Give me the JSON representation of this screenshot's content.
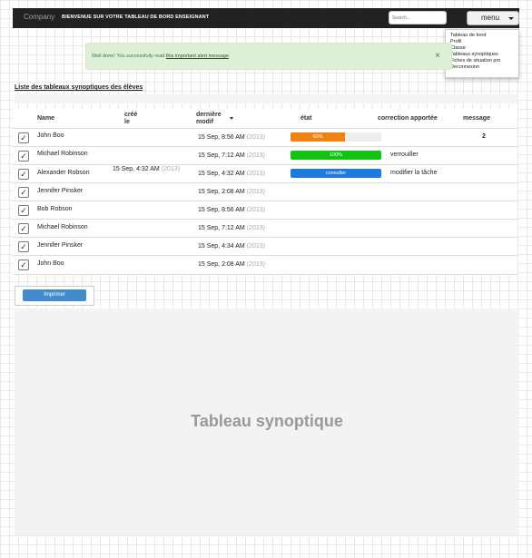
{
  "navbar": {
    "brand": "Company",
    "welcome": "BIENVENUE SUR VOTRE TABLEAU DE BORD ENSEIGNANT",
    "search_placeholder": "Search...",
    "menu_label": "menu"
  },
  "dropdown": {
    "items": [
      "Tableau de bord",
      "Profil",
      "Classe",
      "Tableaux synoptiques",
      "Fiches de situation pro",
      "Deconnexion"
    ]
  },
  "alert": {
    "text": "Well done! You successfully read ",
    "link": "this important alert message",
    "end": ".",
    "close": "×"
  },
  "section": {
    "title": "Liste des tableaux synoptiques des élèves"
  },
  "table": {
    "headers": {
      "name": "Name",
      "created_line1": "créé",
      "created_line2": "le",
      "modified_line1": "dernière",
      "modified_line2": "modif",
      "state": "état",
      "correction": "correction apportée",
      "message": "message"
    },
    "rows": [
      {
        "name": "John Boo",
        "created": "",
        "created_year": "",
        "modified": "15 Sep, 8:56 AM",
        "modified_year": "(2013)",
        "state": "60%",
        "correction": "",
        "message": "2"
      },
      {
        "name": "Michael Robinson",
        "created": "",
        "created_year": "",
        "modified": "15 Sep, 7:12 AM",
        "modified_year": "(2013)",
        "state": "100%",
        "correction": "verrouiller",
        "message": ""
      },
      {
        "name": "Alexander Robson",
        "created": "15 Sep, 4:32 AM",
        "created_year": "(2013)",
        "modified": "15 Sep, 4:32 AM",
        "modified_year": "(2013)",
        "state": "consulter",
        "correction": "modifier la tâche",
        "message": ""
      },
      {
        "name": "Jennifer Pinsker",
        "created": "",
        "created_year": "",
        "modified": "15 Sep, 2:08 AM",
        "modified_year": "(2013)",
        "state": "",
        "correction": "",
        "message": ""
      },
      {
        "name": "Bob Robson",
        "created": "",
        "created_year": "",
        "modified": "15 Sep, 8:56 AM",
        "modified_year": "(2013)",
        "state": "",
        "correction": "",
        "message": ""
      },
      {
        "name": "Michael Robinson",
        "created": "",
        "created_year": "",
        "modified": "15 Sep, 7:12 AM",
        "modified_year": "(2013)",
        "state": "",
        "correction": "",
        "message": ""
      },
      {
        "name": "Jennifer Pinsker",
        "created": "",
        "created_year": "",
        "modified": "15 Sep, 4:34 AM",
        "modified_year": "(2013)",
        "state": "",
        "correction": "",
        "message": ""
      },
      {
        "name": "John Boo",
        "created": "",
        "created_year": "",
        "modified": "15 Sep, 2:08 AM",
        "modified_year": "(2013)",
        "state": "",
        "correction": "",
        "message": ""
      }
    ],
    "progress": {
      "row0": 0.6,
      "row1": 1.0
    },
    "colors": {
      "warning": "#f0820f",
      "success": "#11c411",
      "primary": "#1f7ae0"
    },
    "checkbox_icon": "checkmark-icon",
    "sort_icon": "caret-down-icon"
  },
  "print_button": "Imprimer",
  "synoptic": {
    "title": "Tableau synoptique"
  }
}
